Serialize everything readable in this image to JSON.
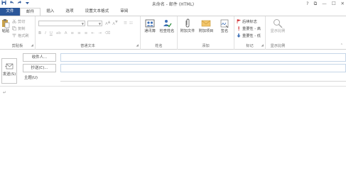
{
  "window": {
    "title": "未命名 - 邮件 (HTML)",
    "controls": [
      "?",
      "⧉",
      "—",
      "☐",
      "✕"
    ]
  },
  "qat": {
    "save_icon": "save-icon",
    "undo_icon": "undo-icon",
    "redo_icon": "redo-icon"
  },
  "tabs": [
    {
      "label": "文件"
    },
    {
      "label": "邮件"
    },
    {
      "label": "插入"
    },
    {
      "label": "选项"
    },
    {
      "label": "设置文本格式"
    },
    {
      "label": "审阅"
    }
  ],
  "ribbon": {
    "clipboard": {
      "label": "剪贴板",
      "paste": "粘贴",
      "cut": "剪切",
      "copy": "复制",
      "format_painter": "格式刷"
    },
    "basic_text": {
      "label": "普通文本"
    },
    "names": {
      "label": "姓名",
      "address_book": "通讯簿",
      "check_names": "检查姓名"
    },
    "include": {
      "label": "添加",
      "attach_file": "附加文件",
      "attach_item": "附加项目",
      "signature": "签名"
    },
    "tags": {
      "label": "标记",
      "follow_up": "后续标志",
      "high_importance": "重要性 - 高",
      "low_importance": "重要性 - 低"
    },
    "zoom": {
      "label": "显示比例",
      "zoom": "显示比例"
    }
  },
  "compose": {
    "send": "发送(S)",
    "to": "收件人...",
    "cc": "抄送(C)...",
    "subject": "主题(U)",
    "body_mark": "↵"
  },
  "colors": {
    "accent": "#2b579a",
    "border": "#d2d2d2"
  }
}
